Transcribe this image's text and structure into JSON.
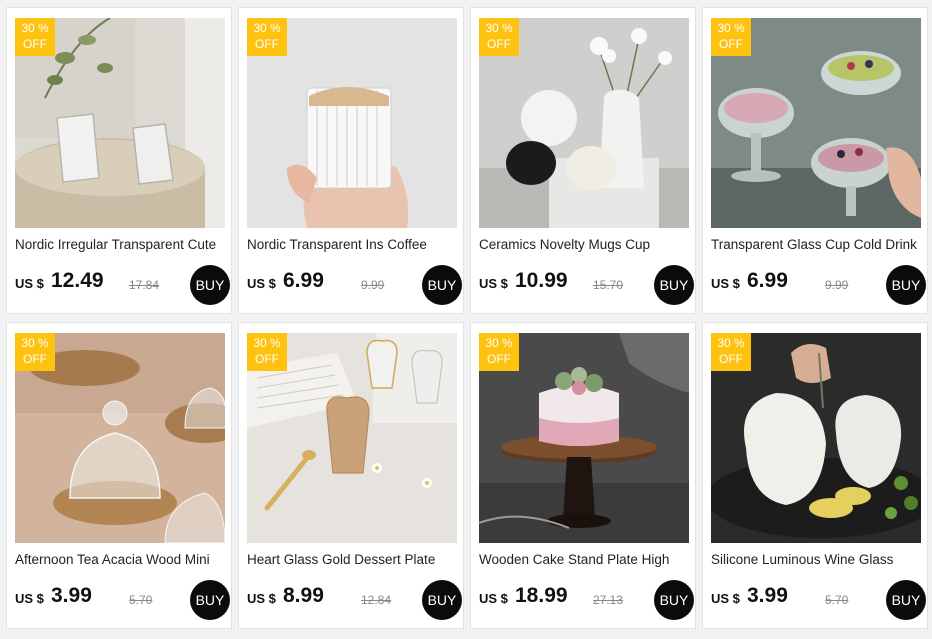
{
  "badge": {
    "line1": "30 %",
    "line2": "OFF"
  },
  "currency": "US $",
  "buy_label": "BUY",
  "products": [
    {
      "title": "Nordic Irregular Transparent Cute",
      "price": "12.49",
      "old_price": "17.84",
      "image": "irregular-glass-cups-photo"
    },
    {
      "title": "Nordic Transparent Ins Coffee",
      "price": "6.99",
      "old_price": "9.99",
      "image": "ribbed-glass-milk-cup-photo"
    },
    {
      "title": "Ceramics Novelty Mugs Cup",
      "price": "10.99",
      "old_price": "15.70",
      "image": "ceramic-novelty-mugs-photo"
    },
    {
      "title": "Transparent Glass Cup Cold Drink",
      "price": "6.99",
      "old_price": "9.99",
      "image": "glass-dessert-bowls-photo"
    },
    {
      "title": "Afternoon Tea Acacia Wood Mini",
      "price": "3.99",
      "old_price": "5.70",
      "image": "glass-dome-wood-plates-photo"
    },
    {
      "title": "Heart Glass Gold Dessert Plate",
      "price": "8.99",
      "old_price": "12.84",
      "image": "heart-glass-cups-photo"
    },
    {
      "title": "Wooden Cake Stand Plate High",
      "price": "18.99",
      "old_price": "27.13",
      "image": "wooden-cake-stand-photo"
    },
    {
      "title": "Silicone Luminous Wine Glass",
      "price": "3.99",
      "old_price": "5.70",
      "image": "silicone-wine-glass-photo"
    }
  ]
}
